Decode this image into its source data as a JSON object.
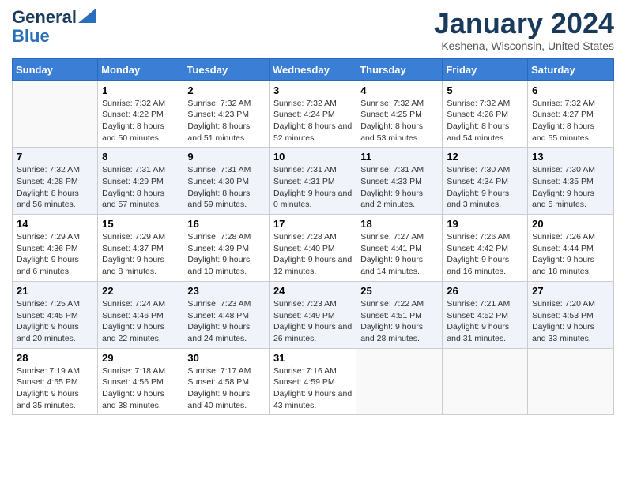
{
  "header": {
    "logo_general": "General",
    "logo_blue": "Blue",
    "month_title": "January 2024",
    "location": "Keshena, Wisconsin, United States"
  },
  "days_of_week": [
    "Sunday",
    "Monday",
    "Tuesday",
    "Wednesday",
    "Thursday",
    "Friday",
    "Saturday"
  ],
  "weeks": [
    [
      {
        "day": "",
        "sunrise": "",
        "sunset": "",
        "daylight": ""
      },
      {
        "day": "1",
        "sunrise": "Sunrise: 7:32 AM",
        "sunset": "Sunset: 4:22 PM",
        "daylight": "Daylight: 8 hours and 50 minutes."
      },
      {
        "day": "2",
        "sunrise": "Sunrise: 7:32 AM",
        "sunset": "Sunset: 4:23 PM",
        "daylight": "Daylight: 8 hours and 51 minutes."
      },
      {
        "day": "3",
        "sunrise": "Sunrise: 7:32 AM",
        "sunset": "Sunset: 4:24 PM",
        "daylight": "Daylight: 8 hours and 52 minutes."
      },
      {
        "day": "4",
        "sunrise": "Sunrise: 7:32 AM",
        "sunset": "Sunset: 4:25 PM",
        "daylight": "Daylight: 8 hours and 53 minutes."
      },
      {
        "day": "5",
        "sunrise": "Sunrise: 7:32 AM",
        "sunset": "Sunset: 4:26 PM",
        "daylight": "Daylight: 8 hours and 54 minutes."
      },
      {
        "day": "6",
        "sunrise": "Sunrise: 7:32 AM",
        "sunset": "Sunset: 4:27 PM",
        "daylight": "Daylight: 8 hours and 55 minutes."
      }
    ],
    [
      {
        "day": "7",
        "sunrise": "Sunrise: 7:32 AM",
        "sunset": "Sunset: 4:28 PM",
        "daylight": "Daylight: 8 hours and 56 minutes."
      },
      {
        "day": "8",
        "sunrise": "Sunrise: 7:31 AM",
        "sunset": "Sunset: 4:29 PM",
        "daylight": "Daylight: 8 hours and 57 minutes."
      },
      {
        "day": "9",
        "sunrise": "Sunrise: 7:31 AM",
        "sunset": "Sunset: 4:30 PM",
        "daylight": "Daylight: 8 hours and 59 minutes."
      },
      {
        "day": "10",
        "sunrise": "Sunrise: 7:31 AM",
        "sunset": "Sunset: 4:31 PM",
        "daylight": "Daylight: 9 hours and 0 minutes."
      },
      {
        "day": "11",
        "sunrise": "Sunrise: 7:31 AM",
        "sunset": "Sunset: 4:33 PM",
        "daylight": "Daylight: 9 hours and 2 minutes."
      },
      {
        "day": "12",
        "sunrise": "Sunrise: 7:30 AM",
        "sunset": "Sunset: 4:34 PM",
        "daylight": "Daylight: 9 hours and 3 minutes."
      },
      {
        "day": "13",
        "sunrise": "Sunrise: 7:30 AM",
        "sunset": "Sunset: 4:35 PM",
        "daylight": "Daylight: 9 hours and 5 minutes."
      }
    ],
    [
      {
        "day": "14",
        "sunrise": "Sunrise: 7:29 AM",
        "sunset": "Sunset: 4:36 PM",
        "daylight": "Daylight: 9 hours and 6 minutes."
      },
      {
        "day": "15",
        "sunrise": "Sunrise: 7:29 AM",
        "sunset": "Sunset: 4:37 PM",
        "daylight": "Daylight: 9 hours and 8 minutes."
      },
      {
        "day": "16",
        "sunrise": "Sunrise: 7:28 AM",
        "sunset": "Sunset: 4:39 PM",
        "daylight": "Daylight: 9 hours and 10 minutes."
      },
      {
        "day": "17",
        "sunrise": "Sunrise: 7:28 AM",
        "sunset": "Sunset: 4:40 PM",
        "daylight": "Daylight: 9 hours and 12 minutes."
      },
      {
        "day": "18",
        "sunrise": "Sunrise: 7:27 AM",
        "sunset": "Sunset: 4:41 PM",
        "daylight": "Daylight: 9 hours and 14 minutes."
      },
      {
        "day": "19",
        "sunrise": "Sunrise: 7:26 AM",
        "sunset": "Sunset: 4:42 PM",
        "daylight": "Daylight: 9 hours and 16 minutes."
      },
      {
        "day": "20",
        "sunrise": "Sunrise: 7:26 AM",
        "sunset": "Sunset: 4:44 PM",
        "daylight": "Daylight: 9 hours and 18 minutes."
      }
    ],
    [
      {
        "day": "21",
        "sunrise": "Sunrise: 7:25 AM",
        "sunset": "Sunset: 4:45 PM",
        "daylight": "Daylight: 9 hours and 20 minutes."
      },
      {
        "day": "22",
        "sunrise": "Sunrise: 7:24 AM",
        "sunset": "Sunset: 4:46 PM",
        "daylight": "Daylight: 9 hours and 22 minutes."
      },
      {
        "day": "23",
        "sunrise": "Sunrise: 7:23 AM",
        "sunset": "Sunset: 4:48 PM",
        "daylight": "Daylight: 9 hours and 24 minutes."
      },
      {
        "day": "24",
        "sunrise": "Sunrise: 7:23 AM",
        "sunset": "Sunset: 4:49 PM",
        "daylight": "Daylight: 9 hours and 26 minutes."
      },
      {
        "day": "25",
        "sunrise": "Sunrise: 7:22 AM",
        "sunset": "Sunset: 4:51 PM",
        "daylight": "Daylight: 9 hours and 28 minutes."
      },
      {
        "day": "26",
        "sunrise": "Sunrise: 7:21 AM",
        "sunset": "Sunset: 4:52 PM",
        "daylight": "Daylight: 9 hours and 31 minutes."
      },
      {
        "day": "27",
        "sunrise": "Sunrise: 7:20 AM",
        "sunset": "Sunset: 4:53 PM",
        "daylight": "Daylight: 9 hours and 33 minutes."
      }
    ],
    [
      {
        "day": "28",
        "sunrise": "Sunrise: 7:19 AM",
        "sunset": "Sunset: 4:55 PM",
        "daylight": "Daylight: 9 hours and 35 minutes."
      },
      {
        "day": "29",
        "sunrise": "Sunrise: 7:18 AM",
        "sunset": "Sunset: 4:56 PM",
        "daylight": "Daylight: 9 hours and 38 minutes."
      },
      {
        "day": "30",
        "sunrise": "Sunrise: 7:17 AM",
        "sunset": "Sunset: 4:58 PM",
        "daylight": "Daylight: 9 hours and 40 minutes."
      },
      {
        "day": "31",
        "sunrise": "Sunrise: 7:16 AM",
        "sunset": "Sunset: 4:59 PM",
        "daylight": "Daylight: 9 hours and 43 minutes."
      },
      {
        "day": "",
        "sunrise": "",
        "sunset": "",
        "daylight": ""
      },
      {
        "day": "",
        "sunrise": "",
        "sunset": "",
        "daylight": ""
      },
      {
        "day": "",
        "sunrise": "",
        "sunset": "",
        "daylight": ""
      }
    ]
  ]
}
